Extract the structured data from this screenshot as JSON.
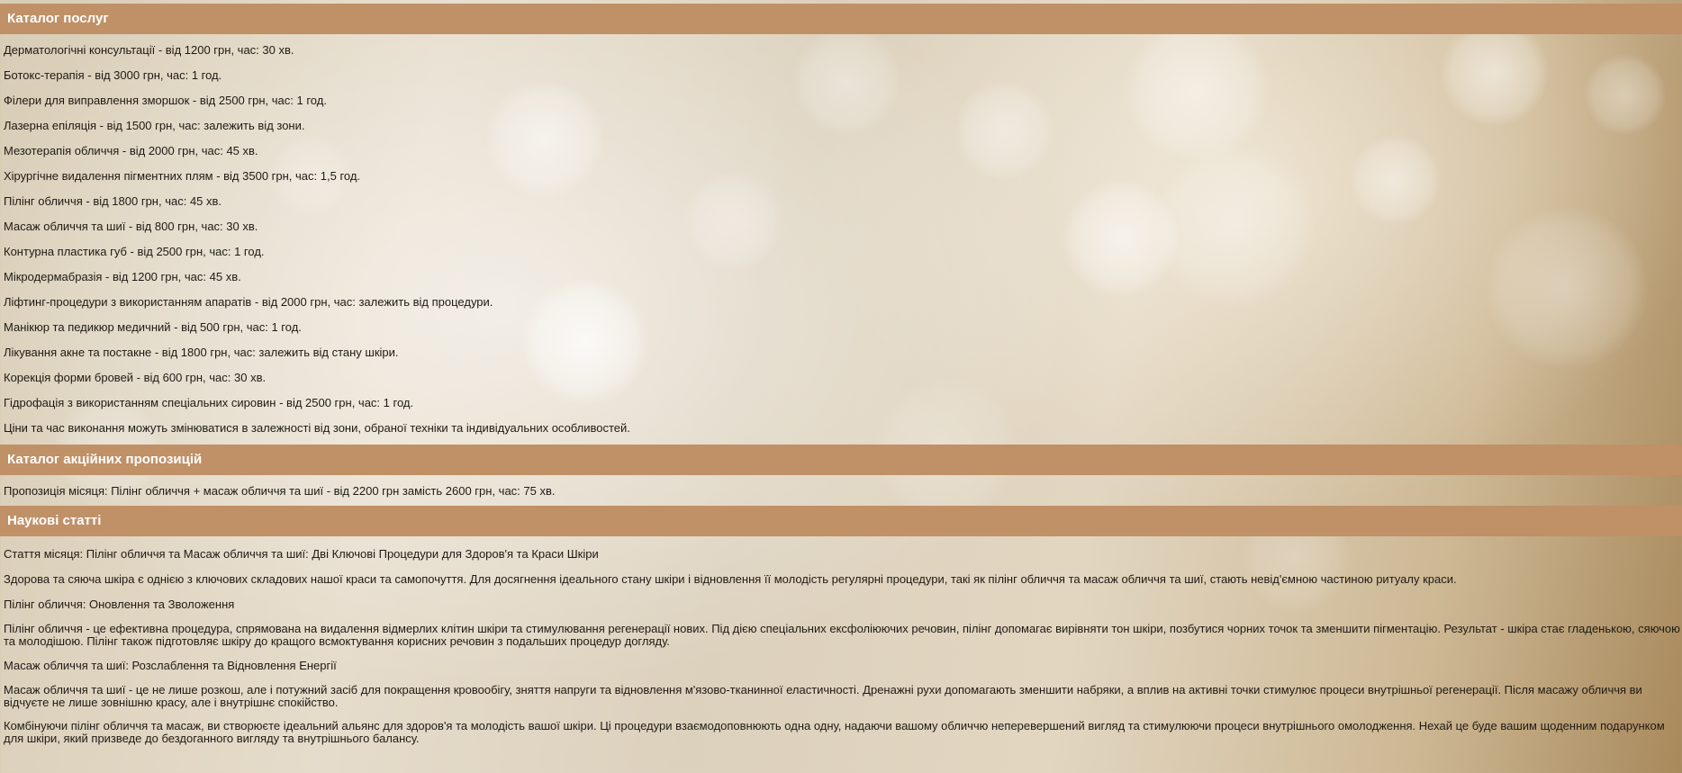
{
  "services": {
    "title": "Каталог послуг",
    "items": [
      "Дерматологічні консультації - від 1200 грн, час: 30 хв.",
      "Ботокс-терапія - від 3000 грн, час: 1 год.",
      "Філери для виправлення зморшок - від 2500 грн, час: 1 год.",
      "Лазерна епіляція - від 1500 грн, час: залежить від зони.",
      "Мезотерапія обличчя - від 2000 грн, час: 45 хв.",
      "Хірургічне видалення пігментних плям - від 3500 грн, час: 1,5 год.",
      "Пілінг обличчя - від 1800 грн, час: 45 хв.",
      "Масаж обличчя та шиї - від 800 грн, час: 30 хв.",
      "Контурна пластика губ - від 2500 грн, час: 1 год.",
      "Мікродермабразія - від 1200 грн, час: 45 хв.",
      "Ліфтинг-процедури з використанням апаратів - від 2000 грн, час: залежить від процедури.",
      "Манікюр та педикюр медичний - від 500 грн, час: 1 год.",
      "Лікування акне та постакне - від 1800 грн, час: залежить від стану шкіри.",
      "Корекція форми бровей - від 600 грн, час: 30 хв.",
      "Гідрофація з використанням спеціальних сировин - від 2500 грн, час: 1 год.",
      "Ціни та час виконання можуть змінюватися в залежності від зони, обраної техніки та індивідуальних особливостей."
    ]
  },
  "offers": {
    "title": "Каталог акційних пропозицій",
    "text": "Пропозиція місяця: Пілінг обличчя + масаж обличчя та шиї - від 2200 грн замість 2600 грн, час: 75 хв."
  },
  "articles": {
    "title": "Наукові статті",
    "paragraphs": [
      "Стаття місяця: Пілінг обличчя та Масаж обличчя та шиї: Дві Ключові Процедури для Здоров'я та Краси Шкіри",
      "Здорова та сяюча шкіра є однією з ключових складових нашої краси та самопочуття. Для досягнення ідеального стану шкіри і відновлення її молодість регулярні процедури, такі як пілінг обличчя та масаж обличчя та шиї, стають невід'ємною частиною ритуалу краси.",
      "Пілінг обличчя: Оновлення та Зволоження",
      "Пілінг обличчя - це ефективна процедура, спрямована на видалення відмерлих клітин шкіри та стимулювання регенерації нових. Під дією спеціальних ексфоліюючих речовин, пілінг допомагає вирівняти тон шкіри, позбутися чорних точок та зменшити пігментацію. Результат - шкіра стає гладенькою, сяючою та молодішою. Пілінг також підготовляє шкіру до кращого всмоктування корисних речовин з подальших процедур догляду.",
      "Масаж обличчя та шиї: Розслаблення та Відновлення Енергії",
      "Масаж обличчя та шиї - це не лише розкош, але і потужний засіб для покращення кровообігу, зняття напруги та відновлення м'язово-тканинної еластичності. Дренажні рухи допомагають зменшити набряки, а вплив на активні точки стимулює процеси внутрішньої регенерації. Після масажу обличчя ви відчуєте не лише зовнішню красу, але і внутрішнє спокійство.",
      "Комбінуючи пілінг обличчя та масаж, ви створюєте ідеальний альянс для здоров'я та молодість вашої шкіри. Ці процедури взаємодоповнюють одна одну, надаючи вашому обличчю неперевершений вигляд та стимулюючи процеси внутрішнього омолодження. Нехай це буде вашим щоденним подарунком для шкіри, який призведе до бездоганного вигляду та внутрішнього балансу."
    ]
  },
  "colors": {
    "header_bg": "#c09066",
    "header_text": "#ffffff",
    "body_text": "#1f1a14"
  }
}
